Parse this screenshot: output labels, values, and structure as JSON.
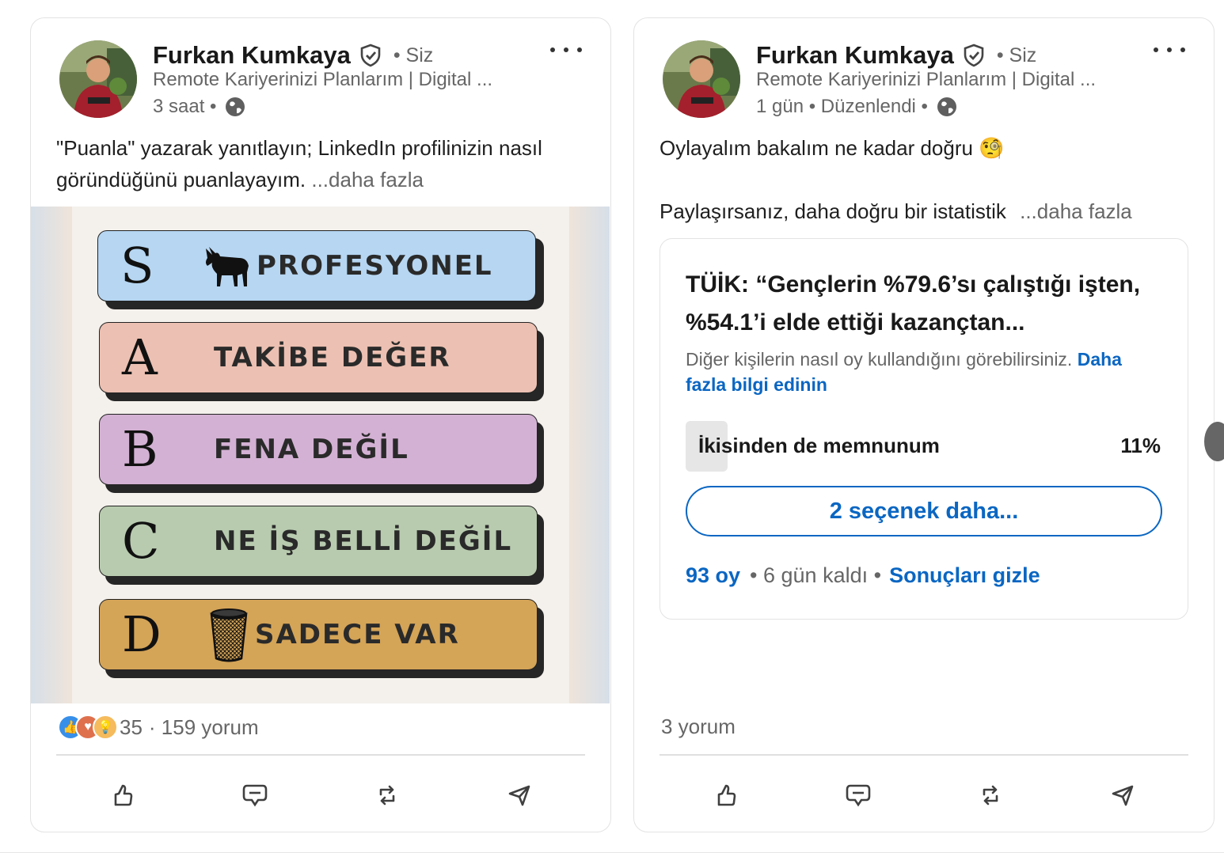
{
  "colors": {
    "link_blue": "#0a66c2",
    "tier_s": "#b6d6f2",
    "tier_a": "#ecc0b2",
    "tier_b": "#d3b1d4",
    "tier_c": "#b8cbaf",
    "tier_d": "#d4a457"
  },
  "posts": [
    {
      "author": "Furkan Kumkaya",
      "you_label": "• Siz",
      "headline": "Remote Kariyerinizi Planlarım | Digital ...",
      "meta": "3 saat •",
      "text": "\"Puanla\" yazarak yanıtlayın; LinkedIn profilinizin nasıl göründüğünü puanlayayım.",
      "see_more": "...daha fazla",
      "tiers": [
        {
          "letter": "S",
          "label": "PROFESYONEL",
          "icon": "goat-icon"
        },
        {
          "letter": "A",
          "label": "TAKİBE DEĞER"
        },
        {
          "letter": "B",
          "label": "FENA DEĞİL"
        },
        {
          "letter": "C",
          "label": "NE İŞ BELLİ DEĞİL"
        },
        {
          "letter": "D",
          "label": "SADECE VAR",
          "icon": "trash-bin-icon"
        }
      ],
      "reaction_count": "35",
      "comments": "· 159 yorum"
    },
    {
      "author": "Furkan Kumkaya",
      "you_label": "• Siz",
      "headline": "Remote Kariyerinizi Planlarım | Digital ...",
      "meta": "1 gün • Düzenlendi •",
      "text_line1": "Oylayalım bakalım ne kadar doğru 🧐",
      "text_line2": "Paylaşırsanız, daha doğru bir istatistik",
      "see_more": "...daha fazla",
      "poll": {
        "question": "TÜİK: “Gençlerin %79.6’sı çalıştığı işten, %54.1’i elde ettiği kazançtan...",
        "note": "Diğer kişilerin nasıl oy kullandığını görebilirsiniz.",
        "note_link": "Daha fazla bilgi edinin",
        "option_label": "İkisinden de memnunum",
        "option_percent": "11%",
        "option_fraction": 0.11,
        "more_options": "2 seçenek daha...",
        "votes": "93 oy",
        "remaining": "• 6 gün kaldı •",
        "hide_results": "Sonuçları gizle"
      },
      "comments": "3 yorum"
    }
  ]
}
